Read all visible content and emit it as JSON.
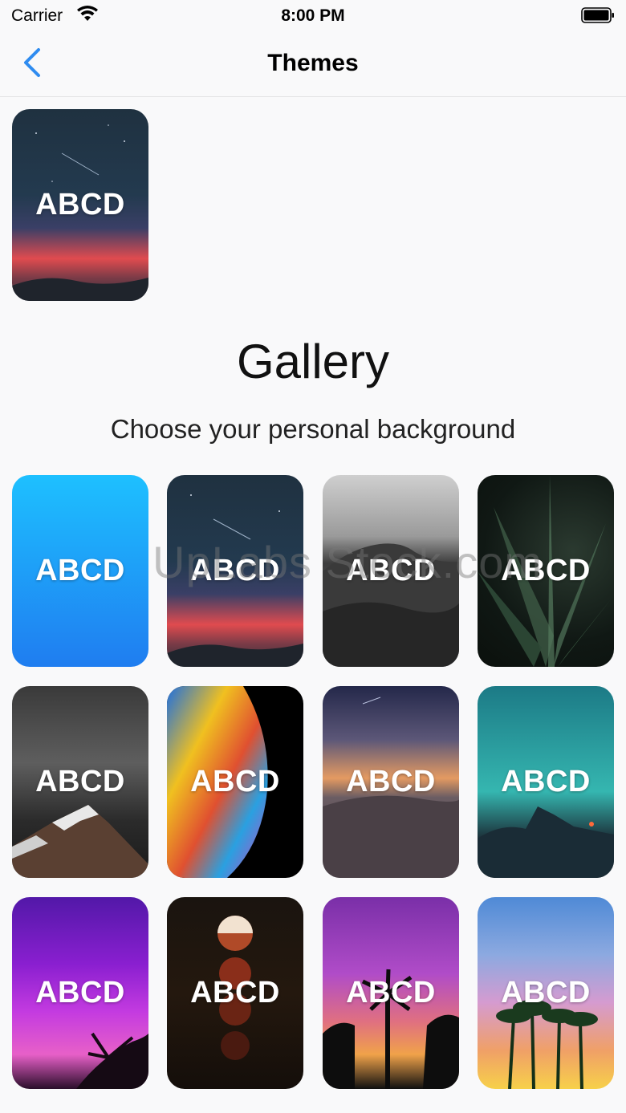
{
  "status_bar": {
    "carrier": "Carrier",
    "time": "8:00 PM"
  },
  "nav": {
    "title": "Themes",
    "back_icon": "chevron-left-icon",
    "accent": "#2f8cf0"
  },
  "selected_theme": {
    "label": "ABCD",
    "background": "night-sky"
  },
  "gallery": {
    "title": "Gallery",
    "subtitle": "Choose your personal background",
    "themes": [
      {
        "label": "ABCD",
        "background": "blue-gradient"
      },
      {
        "label": "ABCD",
        "background": "night-sky"
      },
      {
        "label": "ABCD",
        "background": "rocky-coast"
      },
      {
        "label": "ABCD",
        "background": "aloe-plant"
      },
      {
        "label": "ABCD",
        "background": "snowy-peak"
      },
      {
        "label": "ABCD",
        "background": "colorful-planet"
      },
      {
        "label": "ABCD",
        "background": "desert-dunes"
      },
      {
        "label": "ABCD",
        "background": "teal-night"
      },
      {
        "label": "ABCD",
        "background": "purple-palm"
      },
      {
        "label": "ABCD",
        "background": "lunar-eclipse"
      },
      {
        "label": "ABCD",
        "background": "palm-silhouette"
      },
      {
        "label": "ABCD",
        "background": "palm-sunset"
      }
    ]
  },
  "watermark": "UpLabs Stock.com"
}
